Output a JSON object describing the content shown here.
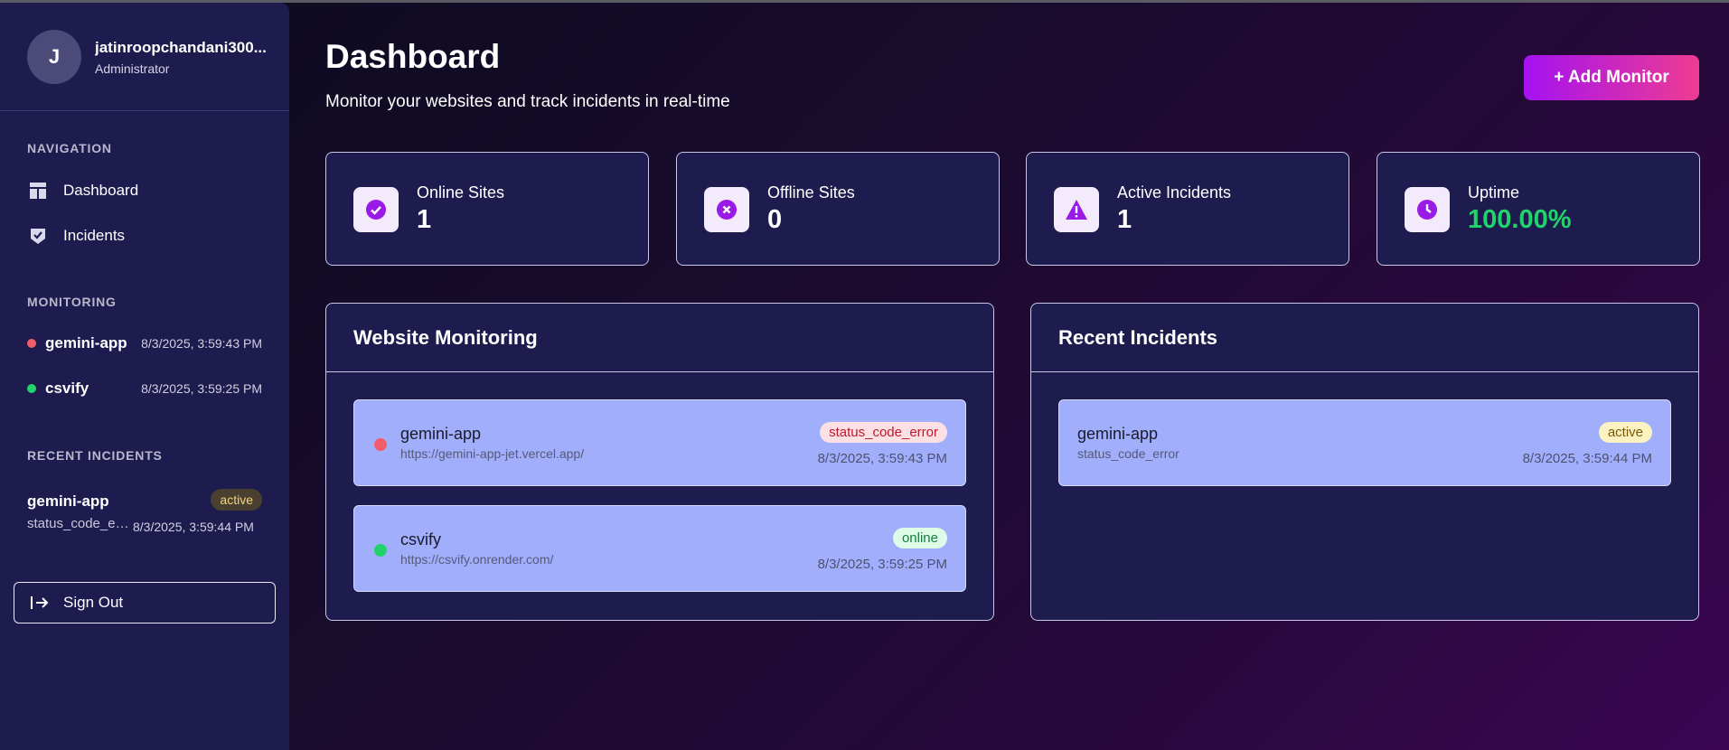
{
  "user": {
    "avatar_letter": "J",
    "name": "jatinroopchandani300...",
    "role": "Administrator"
  },
  "sidebar": {
    "nav_title": "NAVIGATION",
    "nav_items": [
      {
        "label": "Dashboard",
        "icon": "dashboard-icon"
      },
      {
        "label": "Incidents",
        "icon": "incidents-icon"
      }
    ],
    "monitoring_title": "MONITORING",
    "monitoring": [
      {
        "name": "gemini-app",
        "time": "8/3/2025, 3:59:43 PM",
        "status": "down"
      },
      {
        "name": "csvify",
        "time": "8/3/2025, 3:59:25 PM",
        "status": "up"
      }
    ],
    "incidents_title": "RECENT INCIDENTS",
    "incident": {
      "name": "gemini-app",
      "type": "status_code_error",
      "badge": "active",
      "time": "8/3/2025, 3:59:44 PM"
    },
    "signout_label": "Sign Out"
  },
  "header": {
    "title": "Dashboard",
    "subtitle": "Monitor your websites and track incidents in real-time",
    "add_button": "+ Add Monitor"
  },
  "stats": [
    {
      "label": "Online Sites",
      "value": "1",
      "icon": "check-circle-icon"
    },
    {
      "label": "Offline Sites",
      "value": "0",
      "icon": "x-circle-icon"
    },
    {
      "label": "Active Incidents",
      "value": "1",
      "icon": "warning-icon"
    },
    {
      "label": "Uptime",
      "value": "100.00%",
      "icon": "clock-icon"
    }
  ],
  "monitoring_panel": {
    "title": "Website Monitoring",
    "sites": [
      {
        "name": "gemini-app",
        "url": "https://gemini-app-jet.vercel.app/",
        "badge": "status_code_error",
        "time": "8/3/2025, 3:59:43 PM"
      },
      {
        "name": "csvify",
        "url": "https://csvify.onrender.com/",
        "badge": "online",
        "time": "8/3/2025, 3:59:25 PM"
      }
    ]
  },
  "incidents_panel": {
    "title": "Recent Incidents",
    "items": [
      {
        "name": "gemini-app",
        "type": "status_code_error",
        "badge": "active",
        "time": "8/3/2025, 3:59:44 PM"
      }
    ]
  },
  "colors": {
    "accent_purple": "#a412f0",
    "accent_pink": "#ee3c92",
    "online_green": "#22d36b",
    "offline_red": "#f05d6b"
  }
}
